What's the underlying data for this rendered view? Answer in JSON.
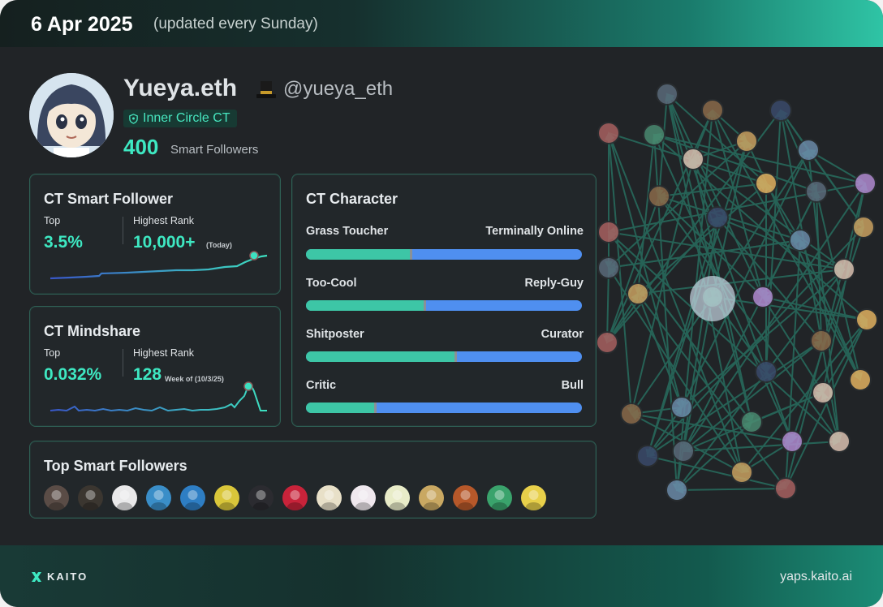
{
  "header": {
    "date": "6 Apr 2025",
    "update_note": "(updated every Sunday)"
  },
  "profile": {
    "name": "Yueya.eth",
    "handle": "@yueya_eth",
    "badge": "Inner Circle CT",
    "smart_followers_count": "400",
    "smart_followers_label": "Smart Followers"
  },
  "smart_follower_panel": {
    "title": "CT Smart Follower",
    "top_label": "Top",
    "top_value": "3.5%",
    "rank_label": "Highest Rank",
    "rank_value": "10,000+",
    "rank_note": "(Today)"
  },
  "mindshare_panel": {
    "title": "CT Mindshare",
    "top_label": "Top",
    "top_value": "0.032%",
    "rank_label": "Highest Rank",
    "rank_value": "128",
    "rank_note": "Week of (10/3/25)"
  },
  "character_panel": {
    "title": "CT Character",
    "traits": [
      {
        "left": "Grass Toucher",
        "right": "Terminally Online",
        "position": 0.38
      },
      {
        "left": "Too-Cool",
        "right": "Reply-Guy",
        "position": 0.43
      },
      {
        "left": "Shitposter",
        "right": "Curator",
        "position": 0.54
      },
      {
        "left": "Critic",
        "right": "Bull",
        "position": 0.25
      }
    ]
  },
  "top_followers_panel": {
    "title": "Top Smart Followers",
    "avatar_colors": [
      "#5a4c46",
      "#3b3630",
      "#e9e9ea",
      "#3a8ec8",
      "#2e7ec4",
      "#d9c63a",
      "#2b2b30",
      "#c8233a",
      "#e8e0c8",
      "#efe8ee",
      "#e8ecc8",
      "#c9a862",
      "#b6582a",
      "#3aa36c",
      "#e8d04a"
    ]
  },
  "colors": {
    "accent": "#3ee8c2",
    "bar_left": "#3dc6a6",
    "bar_right": "#4f8ff0"
  },
  "footer": {
    "brand": "KAITO",
    "site": "yaps.kaito.ai"
  }
}
